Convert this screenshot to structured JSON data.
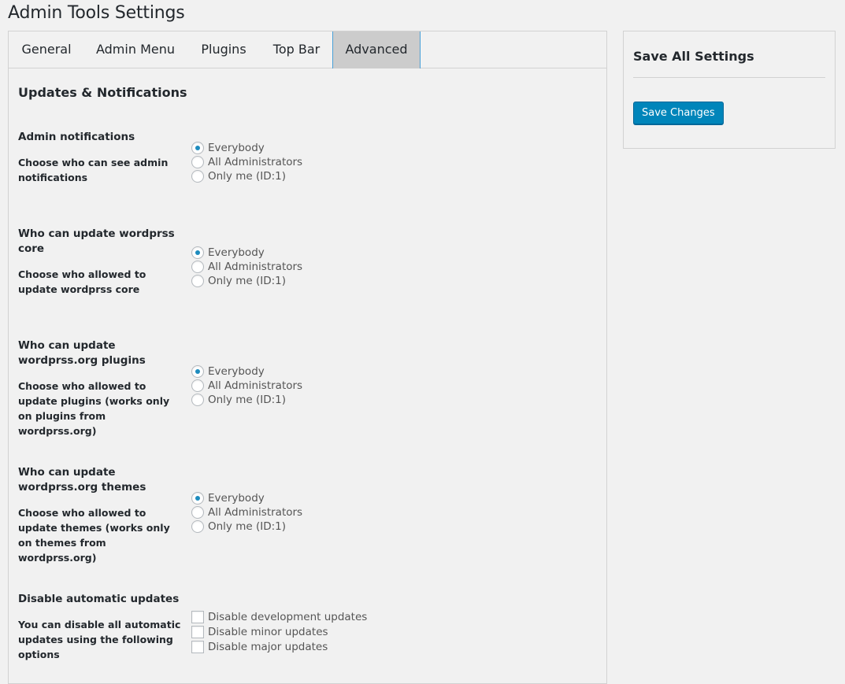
{
  "page": {
    "title": "Admin Tools Settings"
  },
  "tabs": [
    {
      "label": "General"
    },
    {
      "label": "Admin Menu"
    },
    {
      "label": "Plugins"
    },
    {
      "label": "Top Bar"
    },
    {
      "label": "Advanced",
      "active": true
    }
  ],
  "section": {
    "title": "Updates & Notifications"
  },
  "fields": {
    "admin_notifications": {
      "title": "Admin notifications",
      "description": "Choose who can see admin notifications",
      "options": [
        "Everybody",
        "All Administrators",
        "Only me (ID:1)"
      ],
      "selected": "Everybody"
    },
    "update_core": {
      "title": "Who can update wordprss core",
      "description": "Choose who allowed to update wordprss core",
      "options": [
        "Everybody",
        "All Administrators",
        "Only me (ID:1)"
      ],
      "selected": "Everybody"
    },
    "update_plugins": {
      "title": "Who can update wordprss.org plugins",
      "description": "Choose who allowed to update plugins (works only on plugins from wordprss.org)",
      "options": [
        "Everybody",
        "All Administrators",
        "Only me (ID:1)"
      ],
      "selected": "Everybody"
    },
    "update_themes": {
      "title": "Who can update wordprss.org themes",
      "description": "Choose who allowed to update themes (works only on themes from wordprss.org)",
      "options": [
        "Everybody",
        "All Administrators",
        "Only me (ID:1)"
      ],
      "selected": "Everybody"
    },
    "disable_updates": {
      "title": "Disable automatic updates",
      "description": "You can disable all automatic updates using the following options",
      "options": [
        "Disable development updates",
        "Disable minor updates",
        "Disable major updates"
      ],
      "checked": [
        false,
        false,
        false
      ]
    }
  },
  "sidebar": {
    "title": "Save All Settings",
    "save_label": "Save Changes"
  },
  "colors": {
    "accent": "#0085ba",
    "radio_dot": "#1e8cbe",
    "active_tab_bg": "#cccccc",
    "active_tab_border": "#4aa0d8"
  }
}
